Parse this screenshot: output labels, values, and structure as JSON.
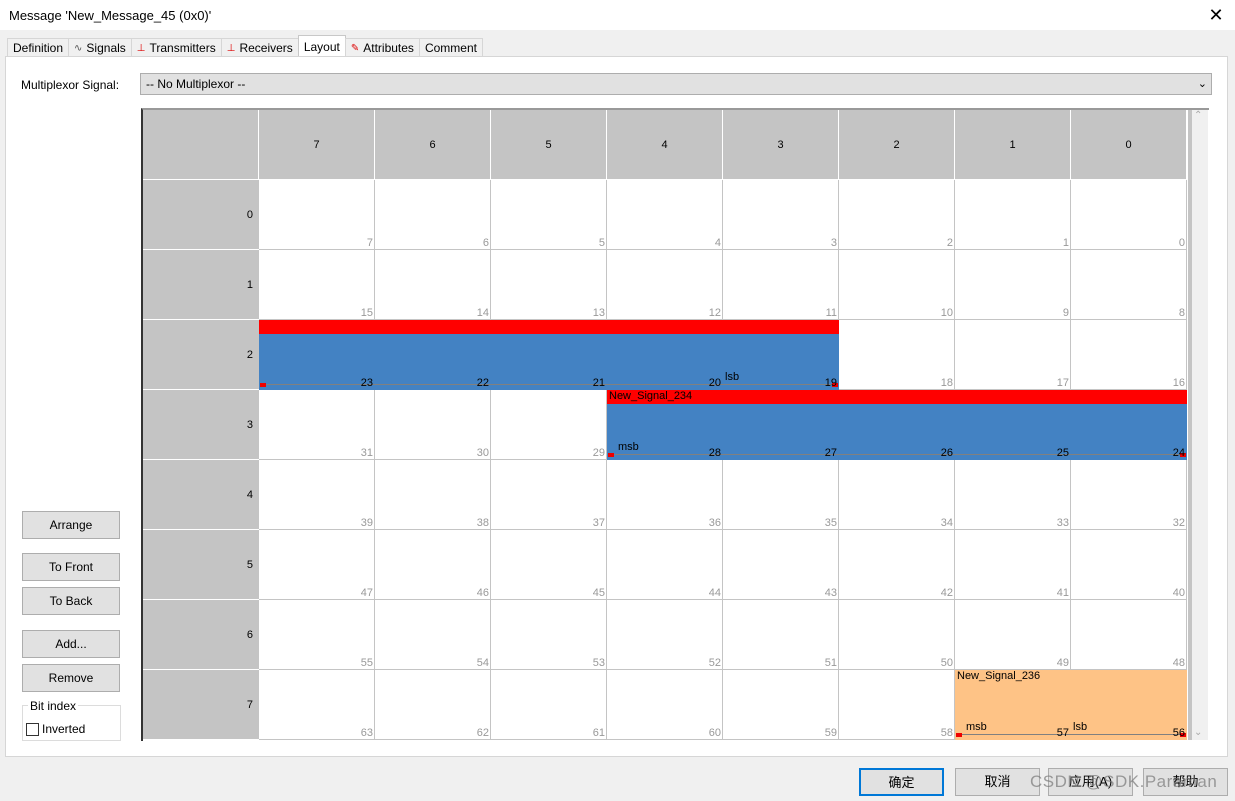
{
  "window": {
    "title": "Message 'New_Message_45 (0x0)'",
    "close": "✕"
  },
  "tabs": [
    {
      "label": "Definition",
      "icon": ""
    },
    {
      "label": "Signals",
      "icon": "signal-wave-icon"
    },
    {
      "label": "Transmitters",
      "icon": "transmitter-icon"
    },
    {
      "label": "Receivers",
      "icon": "receiver-icon"
    },
    {
      "label": "Layout",
      "icon": "",
      "active": true
    },
    {
      "label": "Attributes",
      "icon": "attributes-notepad-icon"
    },
    {
      "label": "Comment",
      "icon": ""
    }
  ],
  "multiplexor": {
    "label": "Multiplexor Signal:",
    "value": "-- No Multiplexor --"
  },
  "grid": {
    "columns": [
      "7",
      "6",
      "5",
      "4",
      "3",
      "2",
      "1",
      "0"
    ],
    "rows": [
      "0",
      "1",
      "2",
      "3",
      "4",
      "5",
      "6",
      "7"
    ],
    "bits": [
      [
        "7",
        "6",
        "5",
        "4",
        "3",
        "2",
        "1",
        "0"
      ],
      [
        "15",
        "14",
        "13",
        "12",
        "11",
        "10",
        "9",
        "8"
      ],
      [
        "23",
        "22",
        "21",
        "20",
        "19",
        "18",
        "17",
        "16"
      ],
      [
        "31",
        "30",
        "29",
        "28",
        "27",
        "26",
        "25",
        "24"
      ],
      [
        "39",
        "38",
        "37",
        "36",
        "35",
        "34",
        "33",
        "32"
      ],
      [
        "47",
        "46",
        "45",
        "44",
        "43",
        "42",
        "41",
        "40"
      ],
      [
        "55",
        "54",
        "53",
        "52",
        "51",
        "50",
        "49",
        "48"
      ],
      [
        "63",
        "62",
        "61",
        "60",
        "59",
        "58",
        "57",
        "56"
      ]
    ],
    "signals": [
      {
        "name": "",
        "row": 2,
        "from_col": 7,
        "to_col": 3,
        "fill": "#4382c3",
        "stripe": "#ff0000",
        "msb_col": 7,
        "lsb_col": 3,
        "msb_label": "",
        "lsb_label": "lsb"
      },
      {
        "name": "New_Signal_234",
        "row": 3,
        "from_col": 4,
        "to_col": 0,
        "fill": "#4382c3",
        "stripe": "#ff0000",
        "msb_col": 4,
        "lsb_col": 0,
        "msb_label": "msb",
        "lsb_label": ""
      },
      {
        "name": "New_Signal_236",
        "row": 7,
        "from_col": 1,
        "to_col": 0,
        "fill": "#fec386",
        "stripe": "",
        "msb_col": 1,
        "lsb_col": 0,
        "msb_label": "msb",
        "lsb_label": "lsb"
      }
    ]
  },
  "left_buttons": {
    "arrange": "Arrange",
    "to_front": "To Front",
    "to_back": "To Back",
    "add": "Add...",
    "remove": "Remove"
  },
  "bit_index": {
    "title": "Bit index",
    "inverted_label": "Inverted",
    "inverted": false
  },
  "footer": {
    "ok": "确定",
    "cancel": "取消",
    "apply": "应用(A)",
    "help": "帮助"
  },
  "watermark": "CSDN @SDK.Paraman"
}
